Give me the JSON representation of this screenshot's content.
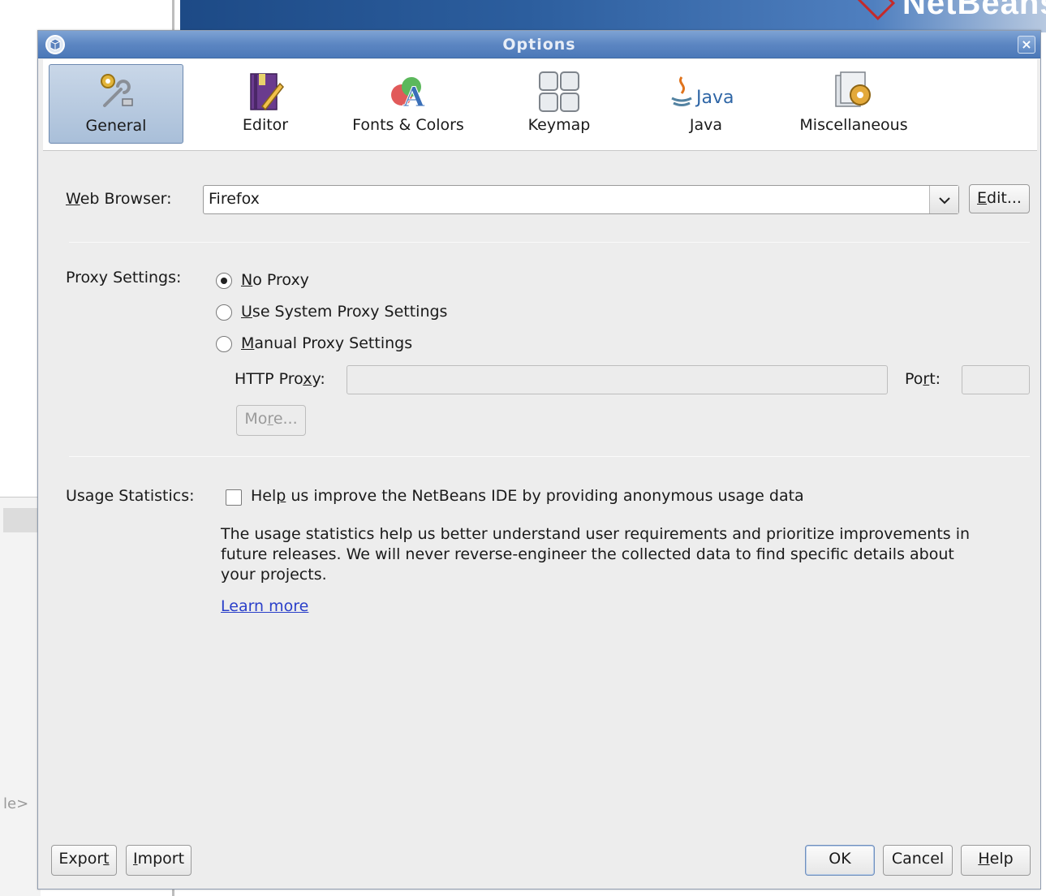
{
  "background": {
    "banner_text": "NetBeansIDE",
    "left_text": "le>"
  },
  "dialog": {
    "title": "Options",
    "close_glyph": "×"
  },
  "categories": [
    {
      "label": "General",
      "icon": "general-tools-icon",
      "selected": true
    },
    {
      "label": "Editor",
      "icon": "editor-book-pen-icon",
      "selected": false
    },
    {
      "label": "Fonts & Colors",
      "icon": "fonts-colors-icon",
      "selected": false
    },
    {
      "label": "Keymap",
      "icon": "keymap-keys-icon",
      "selected": false
    },
    {
      "label": "Java",
      "icon": "java-logo-icon",
      "selected": false
    },
    {
      "label": "Miscellaneous",
      "icon": "miscellaneous-gear-icon",
      "selected": false
    }
  ],
  "java_logo_text": "Java",
  "web_browser": {
    "label_u": "W",
    "label_rest": "eb Browser:",
    "value": "Firefox",
    "edit_u": "E",
    "edit_rest": "dit..."
  },
  "proxy": {
    "label": "Proxy Settings:",
    "options": [
      {
        "u": "N",
        "rest": "o Proxy",
        "checked": true
      },
      {
        "u": "U",
        "rest": "se System Proxy Settings",
        "checked": false
      },
      {
        "u": "M",
        "rest": "anual Proxy Settings",
        "checked": false
      }
    ],
    "http_label_a": "HTTP Pro",
    "http_label_u": "x",
    "http_label_b": "y:",
    "http_value": "",
    "port_label_a": "Po",
    "port_label_u": "r",
    "port_label_b": "t:",
    "port_value": "",
    "more_a": "Mo",
    "more_u": "r",
    "more_b": "e..."
  },
  "usage": {
    "label": "Usage Statistics:",
    "checkbox_a": "Hel",
    "checkbox_u": "p",
    "checkbox_b": " us improve the NetBeans IDE by providing anonymous usage data",
    "checked": false,
    "line1": "The usage statistics help us better understand user requirements and prioritize improvements in",
    "line2": "future releases. We will never reverse-engineer the collected data to find specific details about",
    "line3": "your projects.",
    "learn_more": "Learn more"
  },
  "footer": {
    "export_a": "Expor",
    "export_u": "t",
    "import_u": "I",
    "import_b": "mport",
    "ok": "OK",
    "cancel": "Cancel",
    "help_u": "H",
    "help_b": "elp"
  }
}
